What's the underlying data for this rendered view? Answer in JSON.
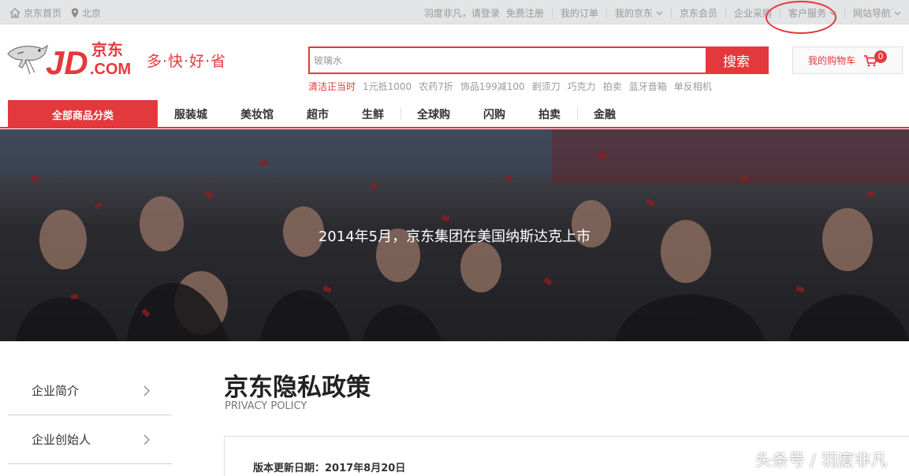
{
  "topbar": {
    "home_label": "京东首页",
    "location_label": "北京",
    "login_prompt": "羽度非凡，请登录",
    "register_label": "免费注册",
    "links": [
      "我的订单",
      "我的京东",
      "京东会员",
      "企业采购",
      "客户服务",
      "网站导航"
    ]
  },
  "header": {
    "logo_text": "JD.京东.COM",
    "slogan": "多·快·好·省",
    "search_placeholder": "玻璃水",
    "search_button": "搜索",
    "hot_words": [
      "清洁正当时",
      "1元抵1000",
      "农药7折",
      "饰品199减100",
      "剃须刀",
      "巧克力",
      "拍卖",
      "蓝牙音箱",
      "单反相机"
    ],
    "cart_label": "我的购物车",
    "cart_count": "0"
  },
  "nav": {
    "category_label": "全部商品分类",
    "items": [
      "服装城",
      "美妆馆",
      "超市",
      "生鲜",
      "全球购",
      "闪购",
      "拍卖",
      "金融"
    ]
  },
  "banner": {
    "caption": "2014年5月，京东集团在美国纳斯达克上市"
  },
  "sidebar": {
    "items": [
      {
        "label": "企业简介"
      },
      {
        "label": "企业创始人"
      }
    ]
  },
  "content": {
    "title": "京东隐私政策",
    "subtitle": "PRIVACY POLICY",
    "update_date": "版本更新日期：2017年8月20日"
  },
  "watermark": "头条号 / 羽度非凡",
  "colors": {
    "brand_red": "#e4393c",
    "topbar_bg": "#e3e4e5"
  }
}
